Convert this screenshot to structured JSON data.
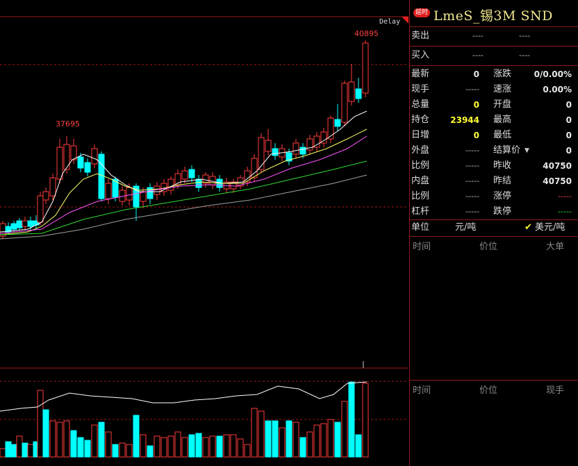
{
  "chart": {
    "delay_label": "Delay",
    "high_label": "40895",
    "mid_label": "37695",
    "colors": {
      "up": "#ff3b3b",
      "down": "#00ffff",
      "ma5": "#ffffff",
      "ma10": "#ffff66",
      "ma20": "#ff55ff",
      "ma40": "#33dd33",
      "ma60": "#a0a0a0",
      "grid": "#a01818"
    }
  },
  "quote": {
    "badge": "延时",
    "title": "LmeS_锡3M SND",
    "sell": {
      "label": "卖出",
      "price": "----",
      "vol": "----"
    },
    "buy": {
      "label": "买入",
      "price": "----",
      "vol": "----"
    },
    "rows": [
      {
        "l1": "最新",
        "v1": "0",
        "l2": "涨跌",
        "v2": "0/0.00%"
      },
      {
        "l1": "现手",
        "v1": "-----",
        "l2": "速涨",
        "v2": "0.00%"
      },
      {
        "l1": "总量",
        "v1": "0",
        "l2": "开盘",
        "v2": "0"
      },
      {
        "l1": "持仓",
        "v1": "23944",
        "l2": "最高",
        "v2": "0"
      },
      {
        "l1": "日增",
        "v1": "0",
        "l2": "最低",
        "v2": "0"
      },
      {
        "l1": "外盘",
        "v1": "-----",
        "l2": "结算价",
        "v2": "0"
      },
      {
        "l1": "比例",
        "v1": "-----",
        "l2": "昨收",
        "v2": "40750"
      },
      {
        "l1": "内盘",
        "v1": "-----",
        "l2": "昨结",
        "v2": "40750"
      },
      {
        "l1": "比例",
        "v1": "-----",
        "l2": "涨停",
        "v2": "-----"
      },
      {
        "l1": "杠杆",
        "v1": "-----",
        "l2": "跌停",
        "v2": "-----"
      }
    ],
    "unit_label": "单位",
    "unit_value": "元/吨",
    "unit_alt": "美元/吨",
    "ticks_header": {
      "time": "时间",
      "price": "价位",
      "big": "大单"
    },
    "trades_header": {
      "time": "时间",
      "price": "价位",
      "hand": "现手"
    }
  }
}
